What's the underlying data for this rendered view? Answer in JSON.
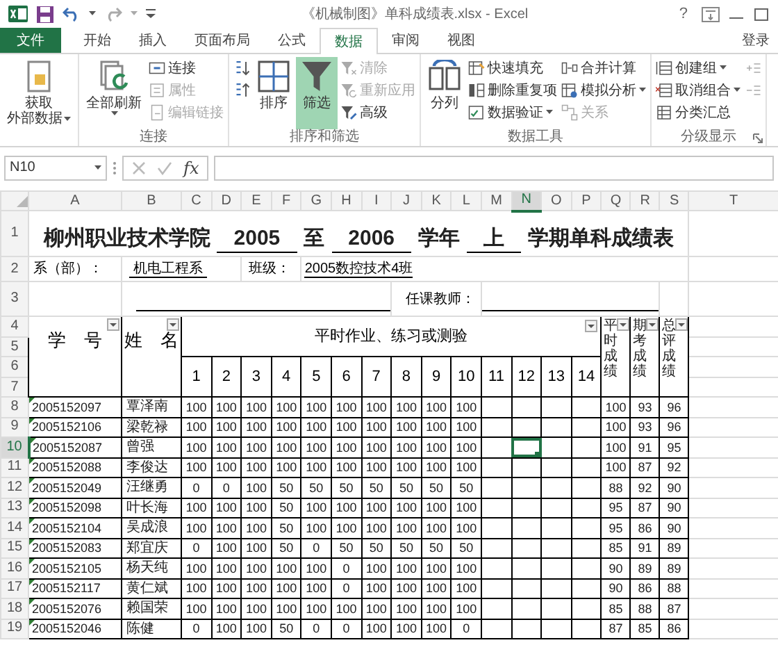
{
  "window": {
    "title": "《机械制图》单科成绩表.xlsx - Excel",
    "help": "?"
  },
  "tabs": [
    {
      "label": "文件",
      "kind": "file",
      "selected": false
    },
    {
      "label": "开始",
      "kind": "tab",
      "selected": false
    },
    {
      "label": "插入",
      "kind": "tab",
      "selected": false
    },
    {
      "label": "页面布局",
      "kind": "tab",
      "selected": false
    },
    {
      "label": "公式",
      "kind": "tab",
      "selected": false
    },
    {
      "label": "数据",
      "kind": "tab",
      "selected": true
    },
    {
      "label": "审阅",
      "kind": "tab",
      "selected": false
    },
    {
      "label": "视图",
      "kind": "tab",
      "selected": false
    }
  ],
  "sign_in": "登录",
  "ribbon": [
    {
      "launcher": false,
      "columns": [
        [
          {
            "lines": [
              "获取",
              "外部数据"
            ],
            "kind": "large",
            "dropdown": true,
            "disabled": false,
            "on": false
          }
        ]
      ]
    },
    {
      "label": "连接",
      "launcher": false,
      "columns": [
        [
          {
            "label": "全部刷新",
            "kind": "large",
            "dropdown": true,
            "disabled": false,
            "on": false
          }
        ],
        [
          {
            "label": "连接",
            "kind": "small",
            "dropdown": false,
            "disabled": false,
            "on": false
          },
          {
            "label": "属性",
            "kind": "small",
            "dropdown": false,
            "disabled": true,
            "on": false
          },
          {
            "label": "编辑链接",
            "kind": "small",
            "dropdown": false,
            "disabled": true,
            "on": false
          }
        ]
      ]
    },
    {
      "label": "排序和筛选",
      "launcher": false,
      "columns": [
        [
          {
            "kind": "small",
            "dropdown": false,
            "disabled": false,
            "on": false
          },
          {
            "kind": "small",
            "dropdown": false,
            "disabled": false,
            "on": false
          }
        ],
        [
          {
            "label": "排序",
            "kind": "large",
            "dropdown": false,
            "disabled": false,
            "on": false
          }
        ],
        [
          {
            "label": "筛选",
            "kind": "large",
            "dropdown": false,
            "disabled": false,
            "on": true
          }
        ],
        [
          {
            "label": "清除",
            "kind": "small",
            "dropdown": false,
            "disabled": true,
            "on": false
          },
          {
            "label": "重新应用",
            "kind": "small",
            "dropdown": false,
            "disabled": true,
            "on": false
          },
          {
            "label": "高级",
            "kind": "small",
            "dropdown": false,
            "disabled": false,
            "on": false
          }
        ]
      ]
    },
    {
      "label": "数据工具",
      "launcher": false,
      "columns": [
        [
          {
            "label": "分列",
            "kind": "large",
            "dropdown": false,
            "disabled": false,
            "on": false
          }
        ],
        [
          {
            "label": "快速填充",
            "kind": "small",
            "dropdown": false,
            "disabled": false,
            "on": false
          },
          {
            "label": "删除重复项",
            "kind": "small",
            "dropdown": false,
            "disabled": false,
            "on": false
          },
          {
            "label": "数据验证",
            "kind": "small",
            "dropdown": true,
            "disabled": false,
            "on": false
          }
        ],
        [
          {
            "label": "合并计算",
            "kind": "small",
            "dropdown": false,
            "disabled": false,
            "on": false
          },
          {
            "label": "模拟分析",
            "kind": "small",
            "dropdown": true,
            "disabled": false,
            "on": false
          },
          {
            "label": "关系",
            "kind": "small",
            "dropdown": false,
            "disabled": true,
            "on": false
          }
        ]
      ]
    },
    {
      "label": "分级显示",
      "launcher": true,
      "columns": [
        [
          {
            "label": "创建组",
            "kind": "small",
            "dropdown": true,
            "disabled": false,
            "on": false
          },
          {
            "label": "取消组合",
            "kind": "small",
            "dropdown": true,
            "disabled": false,
            "on": false
          },
          {
            "label": "分类汇总",
            "kind": "small",
            "dropdown": false,
            "disabled": false,
            "on": false
          }
        ],
        [
          {
            "kind": "small",
            "dropdown": false,
            "disabled": true,
            "on": false
          },
          {
            "kind": "small",
            "dropdown": false,
            "disabled": true,
            "on": false
          }
        ]
      ]
    }
  ],
  "name_box": "N10",
  "function_label": "fx",
  "columns": [
    {
      "label": "A",
      "selected": false
    },
    {
      "label": "B",
      "selected": false
    },
    {
      "label": "C",
      "selected": false
    },
    {
      "label": "D",
      "selected": false
    },
    {
      "label": "E",
      "selected": false
    },
    {
      "label": "F",
      "selected": false
    },
    {
      "label": "G",
      "selected": false
    },
    {
      "label": "H",
      "selected": false
    },
    {
      "label": "I",
      "selected": false
    },
    {
      "label": "J",
      "selected": false
    },
    {
      "label": "K",
      "selected": false
    },
    {
      "label": "L",
      "selected": false
    },
    {
      "label": "M",
      "selected": false
    },
    {
      "label": "N",
      "selected": true
    },
    {
      "label": "O",
      "selected": false
    },
    {
      "label": "P",
      "selected": false
    },
    {
      "label": "Q",
      "selected": false
    },
    {
      "label": "R",
      "selected": false
    },
    {
      "label": "S",
      "selected": false
    },
    {
      "label": "T",
      "selected": false
    }
  ],
  "rows": [
    {
      "label": "1",
      "selected": false
    },
    {
      "label": "2",
      "selected": false
    },
    {
      "label": "3",
      "selected": false
    },
    {
      "label": "4",
      "selected": false
    },
    {
      "label": "5",
      "selected": false
    },
    {
      "label": "6",
      "selected": false
    },
    {
      "label": "7",
      "selected": false
    },
    {
      "label": "8",
      "selected": false
    },
    {
      "label": "9",
      "selected": false
    },
    {
      "label": "10",
      "selected": true
    },
    {
      "label": "11",
      "selected": false
    },
    {
      "label": "12",
      "selected": false
    },
    {
      "label": "13",
      "selected": false
    },
    {
      "label": "14",
      "selected": false
    },
    {
      "label": "15",
      "selected": false
    },
    {
      "label": "16",
      "selected": false
    },
    {
      "label": "17",
      "selected": false
    },
    {
      "label": "18",
      "selected": false
    },
    {
      "label": "19",
      "selected": false
    }
  ],
  "sheet": {
    "title_parts": [
      {
        "text": "柳州职业技术学院",
        "underlined": false
      },
      {
        "text": "2005",
        "underlined": true
      },
      {
        "text": "至",
        "underlined": false
      },
      {
        "text": "2006",
        "underlined": true
      },
      {
        "text": "学年",
        "underlined": false
      },
      {
        "text": "上",
        "underlined": true
      },
      {
        "text": "学期单科成绩表",
        "underlined": false
      }
    ],
    "info": [
      {
        "label": "系（部）：",
        "value": "机电工程系"
      },
      {
        "label": "班级：",
        "value": "2005数控技术4班"
      }
    ],
    "teacher_label": "任课教师：",
    "headers": {
      "id": "学　号",
      "name": "姓　名",
      "homework": "平时作业、练习或测验",
      "numbers": [
        "1",
        "2",
        "3",
        "4",
        "5",
        "6",
        "7",
        "8",
        "9",
        "10",
        "11",
        "12",
        "13",
        "14"
      ],
      "totals": [
        "平时成绩",
        "期考成绩",
        "总评成绩"
      ]
    },
    "students": [
      {
        "id": "2005152097",
        "name": "覃泽南",
        "scores": [
          "100",
          "100",
          "100",
          "100",
          "100",
          "100",
          "100",
          "100",
          "100",
          "100"
        ],
        "totals": [
          "100",
          "93",
          "96"
        ]
      },
      {
        "id": "2005152106",
        "name": "梁乾禄",
        "scores": [
          "100",
          "100",
          "100",
          "100",
          "100",
          "100",
          "100",
          "100",
          "100",
          "100"
        ],
        "totals": [
          "100",
          "93",
          "96"
        ]
      },
      {
        "id": "2005152087",
        "name": "曾强",
        "scores": [
          "100",
          "100",
          "100",
          "100",
          "100",
          "100",
          "100",
          "100",
          "100",
          "100"
        ],
        "totals": [
          "100",
          "91",
          "95"
        ]
      },
      {
        "id": "2005152088",
        "name": "李俊达",
        "scores": [
          "100",
          "100",
          "100",
          "100",
          "100",
          "100",
          "100",
          "100",
          "100",
          "100"
        ],
        "totals": [
          "100",
          "87",
          "92"
        ]
      },
      {
        "id": "2005152049",
        "name": "汪继勇",
        "scores": [
          "0",
          "0",
          "100",
          "50",
          "50",
          "50",
          "50",
          "50",
          "50",
          "50"
        ],
        "totals": [
          "88",
          "92",
          "90"
        ]
      },
      {
        "id": "2005152098",
        "name": "叶长海",
        "scores": [
          "100",
          "100",
          "100",
          "50",
          "100",
          "100",
          "100",
          "100",
          "100",
          "100"
        ],
        "totals": [
          "95",
          "87",
          "90"
        ]
      },
      {
        "id": "2005152104",
        "name": "吴成浪",
        "scores": [
          "100",
          "100",
          "100",
          "50",
          "100",
          "100",
          "100",
          "100",
          "100",
          "100"
        ],
        "totals": [
          "95",
          "86",
          "90"
        ]
      },
      {
        "id": "2005152083",
        "name": "郑宜庆",
        "scores": [
          "0",
          "100",
          "100",
          "50",
          "0",
          "50",
          "50",
          "50",
          "50",
          "50"
        ],
        "totals": [
          "85",
          "91",
          "89"
        ]
      },
      {
        "id": "2005152105",
        "name": "杨天纯",
        "scores": [
          "100",
          "100",
          "100",
          "100",
          "100",
          "0",
          "100",
          "100",
          "100",
          "100"
        ],
        "totals": [
          "90",
          "89",
          "89"
        ]
      },
      {
        "id": "2005152117",
        "name": "黄仁斌",
        "scores": [
          "100",
          "100",
          "100",
          "100",
          "100",
          "0",
          "100",
          "100",
          "100",
          "100"
        ],
        "totals": [
          "90",
          "86",
          "88"
        ]
      },
      {
        "id": "2005152076",
        "name": "赖国荣",
        "scores": [
          "100",
          "100",
          "100",
          "100",
          "100",
          "100",
          "100",
          "100",
          "100",
          "100"
        ],
        "totals": [
          "85",
          "88",
          "87"
        ]
      },
      {
        "id": "2005152046",
        "name": "陈健",
        "scores": [
          "0",
          "100",
          "100",
          "50",
          "0",
          "0",
          "100",
          "100",
          "100",
          "0"
        ],
        "totals": [
          "87",
          "85",
          "86"
        ]
      }
    ]
  }
}
